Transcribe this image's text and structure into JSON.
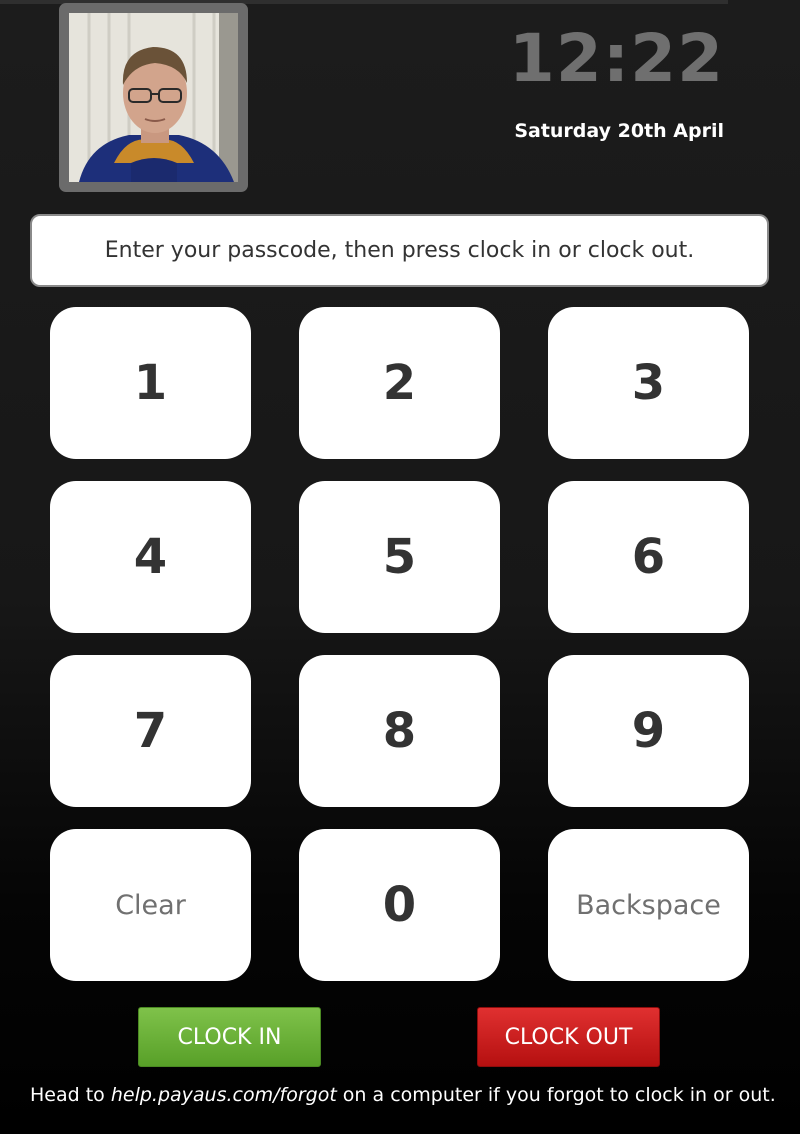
{
  "header": {
    "time": "12:22",
    "date": "Saturday 20th April"
  },
  "message": "Enter your passcode, then press clock in or clock out.",
  "keypad": {
    "keys": [
      "1",
      "2",
      "3",
      "4",
      "5",
      "6",
      "7",
      "8",
      "9",
      "Clear",
      "0",
      "Backspace"
    ]
  },
  "actions": {
    "clock_in": "CLOCK IN",
    "clock_out": "CLOCK OUT"
  },
  "footer": {
    "prefix": "Head to ",
    "link": "help.payaus.com/forgot",
    "suffix": " on a computer if you forgot to clock in or out."
  },
  "colors": {
    "clock_in": "#6cb33f",
    "clock_out": "#cc1f1f",
    "background": "#1a1a1a",
    "key_text": "#333333"
  }
}
